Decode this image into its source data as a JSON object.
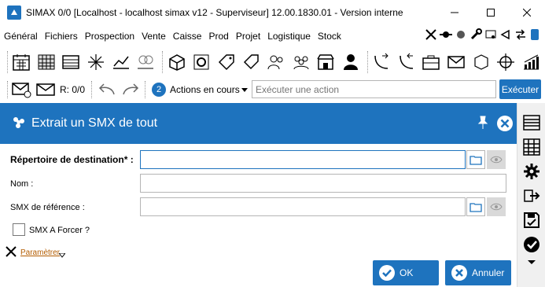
{
  "window": {
    "title": "SIMAX 0/0 [Localhost - localhost simax v12 - Superviseur] 12.00.1830.01 - Version interne"
  },
  "menu": {
    "items": [
      "Général",
      "Fichiers",
      "Prospection",
      "Vente",
      "Caisse",
      "Prod",
      "Projet",
      "Logistique",
      "Stock"
    ]
  },
  "toolbar2": {
    "mail_count": "R: 0/0",
    "actions_count": "2",
    "actions_label": "Actions en cours",
    "action_placeholder": "Exécuter une action",
    "execute_label": "Exécuter"
  },
  "panel": {
    "title": "Extrait un SMX de tout"
  },
  "form": {
    "destination_label": "Répertoire de destination* :",
    "destination_value": "",
    "name_label": "Nom :",
    "name_value": "",
    "reference_label": "SMX de référence :",
    "reference_value": "",
    "force_label": "SMX A Forcer ?",
    "force_checked": false,
    "params_label": "Paramètrer"
  },
  "buttons": {
    "ok_label": "OK",
    "cancel_label": "Annuler"
  },
  "colors": {
    "accent": "#1e73be",
    "link": "#b35c00"
  }
}
